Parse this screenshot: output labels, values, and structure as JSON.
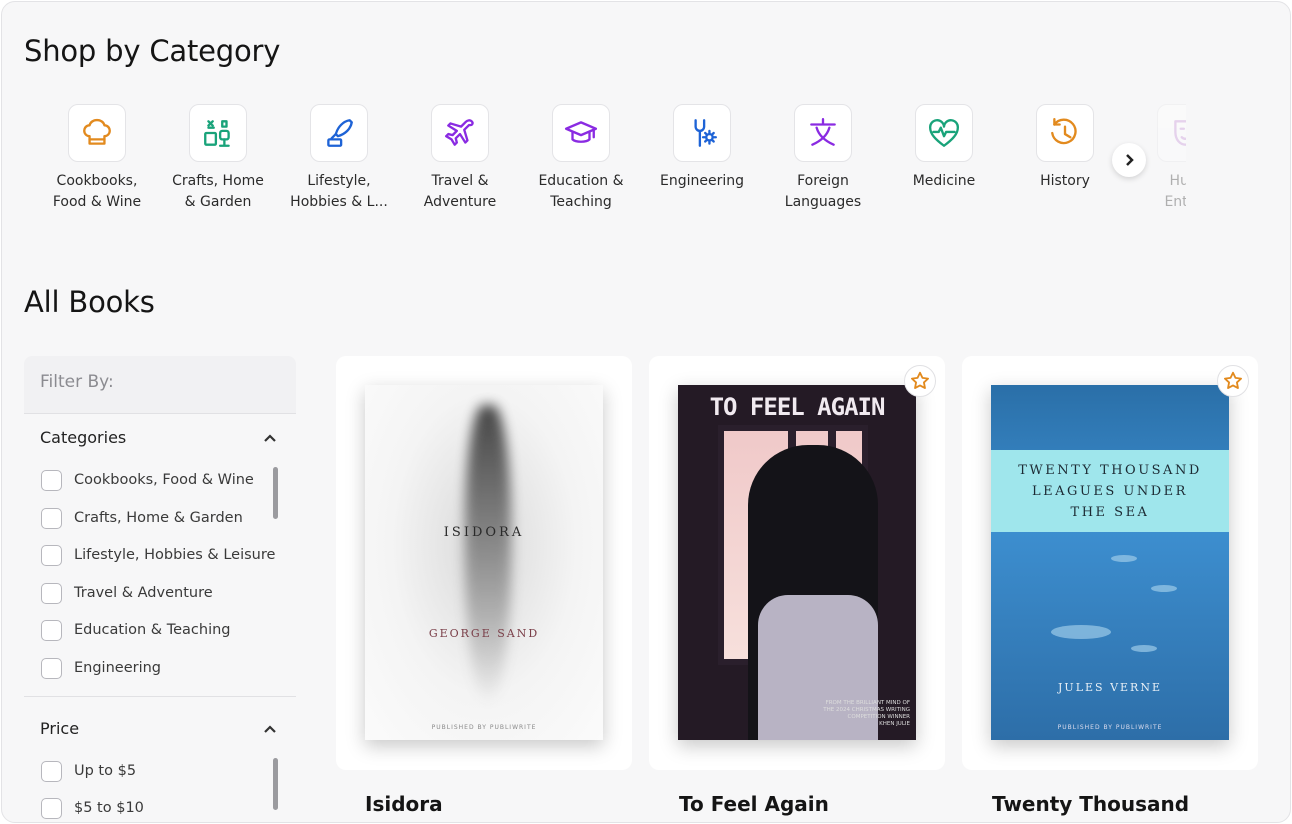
{
  "categories_section": {
    "title": "Shop by Category",
    "items": [
      {
        "label": "Cookbooks,\nFood & Wine",
        "icon": "chef-hat-icon",
        "color": "#e28a1e"
      },
      {
        "label": "Crafts, Home\n& Garden",
        "icon": "crafts-icon",
        "color": "#19a37a"
      },
      {
        "label": "Lifestyle,\nHobbies & L...",
        "icon": "quill-icon",
        "color": "#1e63d6"
      },
      {
        "label": "Travel &\nAdventure",
        "icon": "airplane-icon",
        "color": "#8a2be2"
      },
      {
        "label": "Education &\nTeaching",
        "icon": "graduation-cap-icon",
        "color": "#8a2be2"
      },
      {
        "label": "Engineering",
        "icon": "gear-wrench-icon",
        "color": "#1e63d6"
      },
      {
        "label": "Foreign\nLanguages",
        "icon": "language-icon",
        "color": "#8a2be2"
      },
      {
        "label": "Medicine",
        "icon": "heartbeat-icon",
        "color": "#19a37a"
      },
      {
        "label": "History",
        "icon": "history-icon",
        "color": "#e28a1e"
      },
      {
        "label": "Hum\nEntert",
        "icon": "mask-icon",
        "color": "#c58ed8"
      }
    ]
  },
  "books_section": {
    "title": "All Books"
  },
  "filter": {
    "title": "Filter By:",
    "categories": {
      "title": "Categories",
      "options": [
        "Cookbooks, Food & Wine",
        "Crafts, Home & Garden",
        "Lifestyle, Hobbies & Leisure",
        "Travel & Adventure",
        "Education & Teaching",
        "Engineering"
      ]
    },
    "price": {
      "title": "Price",
      "options": [
        "Up to $5",
        "$5 to $10"
      ]
    }
  },
  "books": [
    {
      "title": "Isidora",
      "cover_title": "ISIDORA",
      "cover_author": "GEORGE SAND",
      "cover_publisher": "PUBLISHED BY PUBLIWRITE",
      "favorite_icon": false
    },
    {
      "title": "To Feel Again",
      "cover_title": "TO FEEL AGAIN",
      "cover_note": "FROM THE BRILLIANT MIND OF THE 2024 CHRISTMAS WRITING COMPETITION WINNER",
      "cover_author": "KHEN JULIE",
      "favorite_icon": true
    },
    {
      "title": "Twenty Thousand",
      "cover_title": "TWENTY THOUSAND LEAGUES UNDER THE SEA",
      "cover_author": "JULES VERNE",
      "cover_publisher": "PUBLISHED BY PUBLIWRITE",
      "favorite_icon": true
    }
  ]
}
